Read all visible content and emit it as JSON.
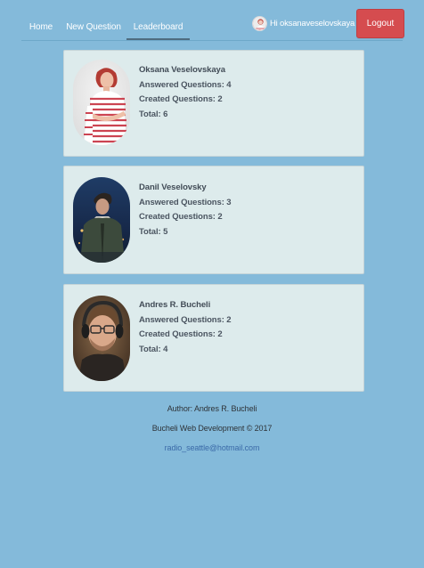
{
  "nav": {
    "home_label": "Home",
    "new_question_label": "New Question",
    "leaderboard_label": "Leaderboard",
    "active_tab": "Leaderboard"
  },
  "user": {
    "greeting": "Hi oksanaveselovskaya",
    "avatar_icon": "user-avatar-icon"
  },
  "logout_label": "Logout",
  "leaderboard": [
    {
      "name": "Oksana Veselovskaya",
      "answered": "Answered Questions: 4",
      "created": "Created Questions: 2",
      "total": "Total: 6"
    },
    {
      "name": "Danil Veselovsky",
      "answered": "Answered Questions: 3",
      "created": "Created Questions: 2",
      "total": "Total: 5"
    },
    {
      "name": "Andres R. Bucheli",
      "answered": "Answered Questions: 2",
      "created": "Created Questions: 2",
      "total": "Total: 4"
    }
  ],
  "footer": {
    "author": "Author: Andres R. Bucheli",
    "company": "Bucheli Web Development © 2017",
    "email": "radio_seattle@hotmail.com"
  },
  "colors": {
    "background": "#84bada",
    "card": "#ddebec",
    "logout": "#d54c4f",
    "link": "#3b6aa8"
  }
}
